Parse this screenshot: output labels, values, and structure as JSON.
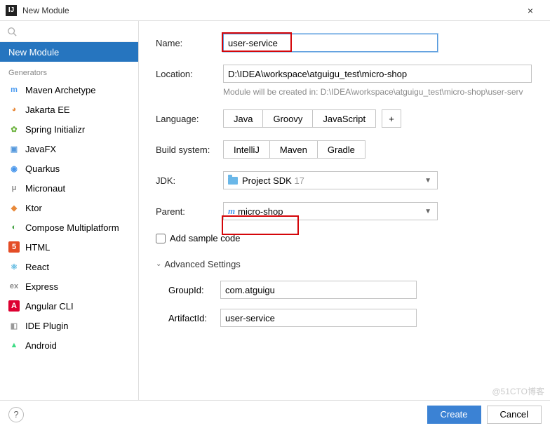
{
  "window": {
    "title": "New Module",
    "close": "×"
  },
  "sidebar": {
    "search_placeholder": "",
    "selected": "New Module",
    "section_label": "Generators",
    "generators": [
      {
        "label": "Maven Archetype",
        "icon_text": "m",
        "icon_bg": "transparent",
        "icon_color": "#4a9af0"
      },
      {
        "label": "Jakarta EE",
        "icon_text": "◕",
        "icon_bg": "transparent",
        "icon_color": "#e8893a"
      },
      {
        "label": "Spring Initializr",
        "icon_text": "✿",
        "icon_bg": "transparent",
        "icon_color": "#6db33f"
      },
      {
        "label": "JavaFX",
        "icon_text": "▣",
        "icon_bg": "transparent",
        "icon_color": "#5599dd"
      },
      {
        "label": "Quarkus",
        "icon_text": "◉",
        "icon_bg": "transparent",
        "icon_color": "#4695eb"
      },
      {
        "label": "Micronaut",
        "icon_text": "μ",
        "icon_bg": "transparent",
        "icon_color": "#888"
      },
      {
        "label": "Ktor",
        "icon_text": "◆",
        "icon_bg": "transparent",
        "icon_color": "#e8893a"
      },
      {
        "label": "Compose Multiplatform",
        "icon_text": "◐",
        "icon_bg": "transparent",
        "icon_color": "#3b9e3b"
      },
      {
        "label": "HTML",
        "icon_text": "5",
        "icon_bg": "#e44d26",
        "icon_color": "#fff"
      },
      {
        "label": "React",
        "icon_text": "⚛",
        "icon_bg": "transparent",
        "icon_color": "#5bb8e0"
      },
      {
        "label": "Express",
        "icon_text": "ex",
        "icon_bg": "transparent",
        "icon_color": "#888"
      },
      {
        "label": "Angular CLI",
        "icon_text": "A",
        "icon_bg": "#dd0031",
        "icon_color": "#fff"
      },
      {
        "label": "IDE Plugin",
        "icon_text": "◧",
        "icon_bg": "transparent",
        "icon_color": "#999"
      },
      {
        "label": "Android",
        "icon_text": "▲",
        "icon_bg": "transparent",
        "icon_color": "#3ddc84"
      }
    ]
  },
  "form": {
    "name_label": "Name:",
    "name_value": "user-service",
    "location_label": "Location:",
    "location_value": "D:\\IDEA\\workspace\\atguigu_test\\micro-shop",
    "location_hint": "Module will be created in: D:\\IDEA\\workspace\\atguigu_test\\micro-shop\\user-serv",
    "language_label": "Language:",
    "languages": [
      "Java",
      "Groovy",
      "JavaScript"
    ],
    "plus": "+",
    "build_label": "Build system:",
    "build_systems": [
      "IntelliJ",
      "Maven",
      "Gradle"
    ],
    "jdk_label": "JDK:",
    "jdk_value": "Project SDK",
    "jdk_version": "17",
    "parent_label": "Parent:",
    "parent_value": "micro-shop",
    "sample_label": "Add sample code",
    "advanced_header": "Advanced Settings",
    "groupid_label": "GroupId:",
    "groupid_value": "com.atguigu",
    "artifactid_label": "ArtifactId:",
    "artifactid_value": "user-service"
  },
  "footer": {
    "help": "?",
    "create": "Create",
    "cancel": "Cancel"
  },
  "watermark": "@51CTO博客"
}
